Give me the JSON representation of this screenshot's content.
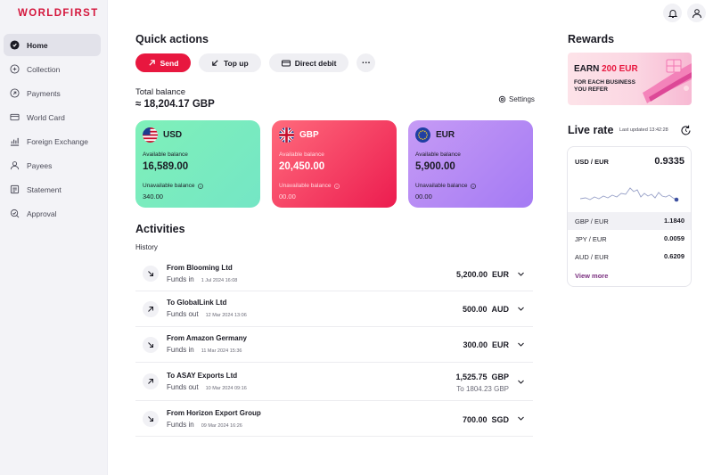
{
  "brand": {
    "logo_text": "WORLDFIRST",
    "accent": "#d4163c"
  },
  "sidebar": {
    "items": [
      {
        "label": "Home",
        "icon": "home-icon",
        "active": true
      },
      {
        "label": "Collection",
        "icon": "collection-icon"
      },
      {
        "label": "Payments",
        "icon": "payments-icon"
      },
      {
        "label": "World Card",
        "icon": "card-icon"
      },
      {
        "label": "Foreign Exchange",
        "icon": "chart-icon"
      },
      {
        "label": "Payees",
        "icon": "payees-icon"
      },
      {
        "label": "Statement",
        "icon": "statement-icon"
      },
      {
        "label": "Approval",
        "icon": "approval-icon"
      }
    ]
  },
  "header": {
    "icons": [
      "bell-icon",
      "user-icon"
    ]
  },
  "quick_actions": {
    "title": "Quick actions",
    "send": "Send",
    "top_up": "Top up",
    "direct_debit": "Direct debit",
    "more": "..."
  },
  "balance": {
    "label": "Total balance",
    "value": "≈ 18,204.17 GBP",
    "settings": "Settings"
  },
  "cards": [
    {
      "code": "USD",
      "available_label": "Available balance",
      "available": "16,589.00",
      "unavailable_label": "Unavailable balance",
      "unavailable": "340.00",
      "color": "#7ff0b9"
    },
    {
      "code": "GBP",
      "available_label": "Available balance",
      "available": "20,450.00",
      "unavailable_label": "Unavailable balance",
      "unavailable": "00.00",
      "color": "#ec1c4f"
    },
    {
      "code": "EUR",
      "available_label": "Available balance",
      "available": "5,900.00",
      "unavailable_label": "Unavailable balance",
      "unavailable": "00.00",
      "color": "#b48bf5"
    }
  ],
  "activities": {
    "title": "Activities",
    "history_label": "History",
    "items": [
      {
        "title": "From Blooming Ltd",
        "type": "Funds in",
        "date": "1 Jul 2024 16:08",
        "amount": "5,200.00",
        "currency": "EUR",
        "direction": "in",
        "sub": ""
      },
      {
        "title": "To GlobalLink Ltd",
        "type": "Funds out",
        "date": "12 Mar 2024 13:06",
        "amount": "500.00",
        "currency": "AUD",
        "direction": "out",
        "sub": ""
      },
      {
        "title": "From Amazon Germany",
        "type": "Funds in",
        "date": "11 Mar 2024 15:36",
        "amount": "300.00",
        "currency": "EUR",
        "direction": "in",
        "sub": ""
      },
      {
        "title": "To ASAY Exports Ltd",
        "type": "Funds out",
        "date": "10 Mar 2024 09:16",
        "amount": "1,525.75",
        "currency": "GBP",
        "direction": "out",
        "sub": "To 1804.23 GBP"
      },
      {
        "title": "From Horizon Export Group",
        "type": "Funds in",
        "date": "09 Mar 2024 16:26",
        "amount": "700.00",
        "currency": "SGD",
        "direction": "in",
        "sub": ""
      }
    ]
  },
  "rewards": {
    "title": "Rewards",
    "earn_prefix": "EARN ",
    "earn_amount": "200 EUR",
    "sub": "FOR EACH BUSINESS YOU REFER"
  },
  "live_rate": {
    "title": "Live rate",
    "updated": "Last updated 13:42:28",
    "main_pair": "USD / EUR",
    "main_rate": "0.9335",
    "rows": [
      {
        "pair": "GBP / EUR",
        "rate": "1.1840",
        "selected": true
      },
      {
        "pair": "JPY / EUR",
        "rate": "0.0059",
        "selected": false
      },
      {
        "pair": "AUD / EUR",
        "rate": "0.6209",
        "selected": false
      }
    ],
    "view_more": "View more"
  }
}
